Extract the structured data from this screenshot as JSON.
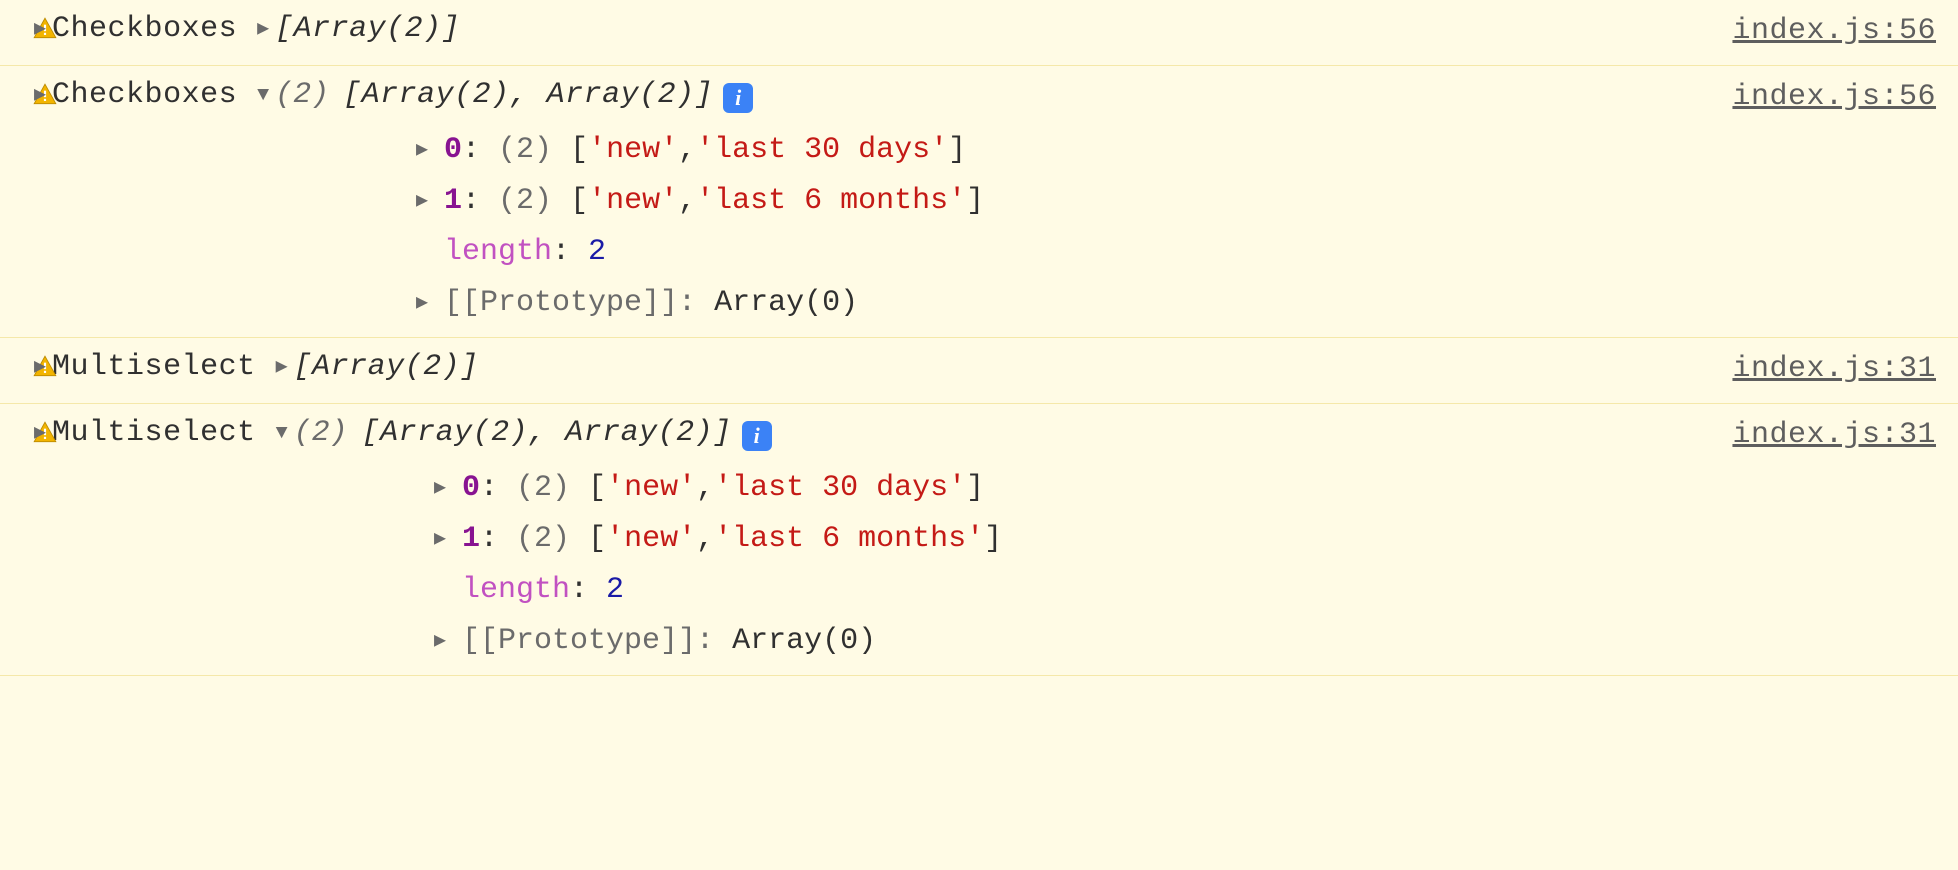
{
  "icons": {
    "info_letter": "i"
  },
  "rows": [
    {
      "label": "Checkboxes",
      "collapsed_preview": "[Array(2)]",
      "source": "index.js:56"
    },
    {
      "label": "Checkboxes",
      "expanded_count": "(2)",
      "expanded_preview": "[Array(2), Array(2)]",
      "source": "index.js:56",
      "children": {
        "idx0_key": "0",
        "idx0_count": "(2)",
        "idx0_br_open": "[",
        "idx0_v0": "'new'",
        "idx0_sep": ", ",
        "idx0_v1": "'last 30 days'",
        "idx0_br_close": "]",
        "idx1_key": "1",
        "idx1_count": "(2)",
        "idx1_br_open": "[",
        "idx1_v0": "'new'",
        "idx1_sep": ", ",
        "idx1_v1": "'last 6 months'",
        "idx1_br_close": "]",
        "length_key": "length",
        "length_val": "2",
        "proto_key": "[[Prototype]]",
        "proto_val": "Array(0)"
      }
    },
    {
      "label": "Multiselect",
      "collapsed_preview": "[Array(2)]",
      "source": "index.js:31"
    },
    {
      "label": "Multiselect",
      "expanded_count": "(2)",
      "expanded_preview": "[Array(2), Array(2)]",
      "source": "index.js:31",
      "children": {
        "idx0_key": "0",
        "idx0_count": "(2)",
        "idx0_br_open": "[",
        "idx0_v0": "'new'",
        "idx0_sep": ", ",
        "idx0_v1": "'last 30 days'",
        "idx0_br_close": "]",
        "idx1_key": "1",
        "idx1_count": "(2)",
        "idx1_br_open": "[",
        "idx1_v0": "'new'",
        "idx1_sep": ", ",
        "idx1_v1": "'last 6 months'",
        "idx1_br_close": "]",
        "length_key": "length",
        "length_val": "2",
        "proto_key": "[[Prototype]]",
        "proto_val": "Array(0)"
      }
    }
  ]
}
